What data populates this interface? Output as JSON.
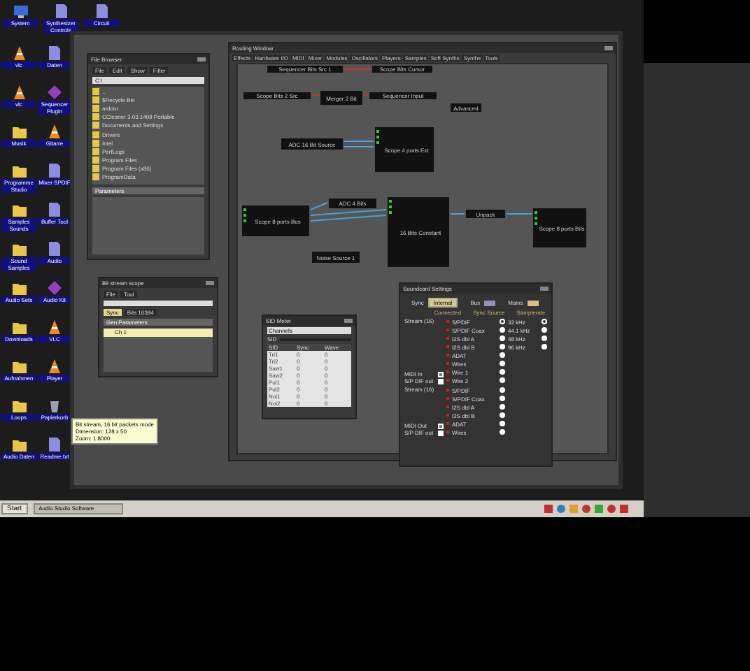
{
  "desktop_top_icons": [
    {
      "label": "System",
      "kind": "computer"
    },
    {
      "label": "Synthesizer Controls",
      "kind": "doc"
    },
    {
      "label": "Circuit",
      "kind": "doc"
    }
  ],
  "desktop_icons": [
    {
      "label": "vlc",
      "kind": "cone"
    },
    {
      "label": "Daten",
      "kind": "doc"
    },
    {
      "label": "vlc",
      "kind": "cone"
    },
    {
      "label": "Sequencer Plugin",
      "kind": "app"
    },
    {
      "label": "Musik",
      "kind": "folder"
    },
    {
      "label": "Gitarre",
      "kind": "cone"
    },
    {
      "label": "Programme Studio",
      "kind": "folder"
    },
    {
      "label": "Mixer SPDIF",
      "kind": "doc"
    },
    {
      "label": "Samples Sounds",
      "kind": "folder"
    },
    {
      "label": "Buffer Tool",
      "kind": "doc"
    },
    {
      "label": "Sound Samples",
      "kind": "folder"
    },
    {
      "label": "Audio",
      "kind": "doc"
    },
    {
      "label": "Audio Sets",
      "kind": "folder"
    },
    {
      "label": "Audio Kit",
      "kind": "app"
    },
    {
      "label": "Downloads",
      "kind": "folder"
    },
    {
      "label": "VLC",
      "kind": "cone"
    },
    {
      "label": "Aufnahmen",
      "kind": "folder"
    },
    {
      "label": "Player",
      "kind": "cone"
    },
    {
      "label": "Loops",
      "kind": "folder"
    },
    {
      "label": "Papierkorb",
      "kind": "bin"
    },
    {
      "label": "Audio Daten",
      "kind": "folder"
    },
    {
      "label": "Readme.txt",
      "kind": "doc"
    }
  ],
  "file_browser": {
    "title": "File Browser",
    "menu": [
      "File",
      "Edit",
      "Show",
      "Filter"
    ],
    "path": "C:\\",
    "items": [
      "..",
      "$Recycle.Bin",
      "ardour",
      "CCleaner 3.03.1409 Portable",
      "Documents and Settings",
      "Drivers",
      "Intel",
      "PerfLogs",
      "Program Files",
      "Program Files (x86)",
      "ProgramData"
    ],
    "panel_title": "Parameters"
  },
  "scope": {
    "title": "Bit stream scope",
    "menu": [
      "File",
      "Tool"
    ],
    "mode": "Sync",
    "value": "Bits 16384",
    "list_title": "Gen Parameters",
    "rows": [
      {
        "label": "Ch 1",
        "selected": true
      }
    ]
  },
  "tooltip": [
    "Bit stream, 16 bit packets mode",
    "Dimension: 128 x 50",
    "Zoom: 1.8000"
  ],
  "routing": {
    "title": "Routing Window",
    "tabs": [
      {
        "label": "Effects",
        "selected": false
      },
      {
        "label": "Hardware I/O",
        "selected": false
      },
      {
        "label": "MIDI",
        "selected": false
      },
      {
        "label": "Mixer",
        "selected": false
      },
      {
        "label": "Modules",
        "selected": false
      },
      {
        "label": "Oscillators",
        "selected": false
      },
      {
        "label": "Players",
        "selected": false
      },
      {
        "label": "Samples",
        "selected": false
      },
      {
        "label": "Soft Synths",
        "selected": false
      },
      {
        "label": "Synths",
        "selected": false
      },
      {
        "label": "Tools",
        "selected": false
      }
    ],
    "nodes": [
      {
        "label": "Sequencer Bits Src 1",
        "kind": "strip"
      },
      {
        "label": "Scope Bits Cursor",
        "kind": "strip"
      },
      {
        "label": "Scope Bits 2 Src",
        "kind": "strip"
      },
      {
        "label": "Merger 2 Bit",
        "kind": "strip"
      },
      {
        "label": "Sequencer Input",
        "kind": "strip"
      },
      {
        "label": "Advanced",
        "kind": "strip"
      },
      {
        "label": "ADC 16 Bit Source",
        "kind": "strip"
      },
      {
        "label": "Scope 4 ports Ext",
        "kind": "block"
      },
      {
        "label": "Scope 8 ports Bus",
        "kind": "block"
      },
      {
        "label": "ADC 4 Bits",
        "kind": "strip"
      },
      {
        "label": "16 Bits Constant",
        "kind": "block"
      },
      {
        "label": "Noise Source 1",
        "kind": "strip"
      },
      {
        "label": "Unpack",
        "kind": "strip"
      },
      {
        "label": "Scope 8 ports Bits",
        "kind": "block"
      }
    ]
  },
  "sid_meter": {
    "title": "SID Meter",
    "field": "Channels",
    "chip": "SID",
    "columns": [
      "SID",
      "Sync",
      "Wave"
    ],
    "rows": [
      [
        "Tri1",
        "0",
        "0"
      ],
      [
        "Tri2",
        "0",
        "0"
      ],
      [
        "Saw1",
        "0",
        "0"
      ],
      [
        "Saw2",
        "0",
        "0"
      ],
      [
        "Pul1",
        "0",
        "0"
      ],
      [
        "Pul2",
        "0",
        "0"
      ],
      [
        "Noi1",
        "0",
        "0"
      ],
      [
        "Noi2",
        "0",
        "0"
      ]
    ]
  },
  "soundcard": {
    "title": "Soundcard Settings",
    "sync_label": "Sync",
    "sync_value": "Internal",
    "bus_label": "Bus",
    "mains_label": "Mains",
    "headings": [
      "Connected",
      "Sync Source",
      "Samplerate"
    ],
    "samplerates": [
      {
        "label": "32 kHz",
        "selected": true
      },
      {
        "label": "44.1 kHz",
        "selected": false
      },
      {
        "label": "48 kHz",
        "selected": false
      },
      {
        "label": "96 kHz",
        "selected": false
      }
    ],
    "groups": [
      {
        "title": "Stream (16)",
        "sources": [
          {
            "label": "S/PDIF",
            "selected": true
          },
          {
            "label": "S/PDIF Coax",
            "selected": false
          },
          {
            "label": "I2S dbl A",
            "selected": false
          },
          {
            "label": "I2S dbl B",
            "selected": false
          },
          {
            "label": "ADAT",
            "selected": false
          },
          {
            "label": "Wires",
            "selected": false
          },
          {
            "label": "Wire 1",
            "selected": false
          },
          {
            "label": "Wire 2",
            "selected": false
          }
        ],
        "checks": [
          {
            "label": "MIDI In",
            "checked": false
          },
          {
            "label": "S/P DIF out",
            "checked": true
          }
        ]
      },
      {
        "title": "Stream (16)",
        "sources": [
          {
            "label": "S/PDIF",
            "selected": false
          },
          {
            "label": "S/PDIF Coax",
            "selected": false
          },
          {
            "label": "I2S dbl A",
            "selected": false
          },
          {
            "label": "I2S dbl B",
            "selected": false
          },
          {
            "label": "ADAT",
            "selected": false
          },
          {
            "label": "Wires",
            "selected": false
          }
        ],
        "checks": [
          {
            "label": "MIDI Out",
            "checked": false
          },
          {
            "label": "S/P DIF out",
            "checked": true
          }
        ]
      }
    ]
  },
  "taskbar": {
    "start": "Start",
    "task": "Audio Studio Software"
  }
}
